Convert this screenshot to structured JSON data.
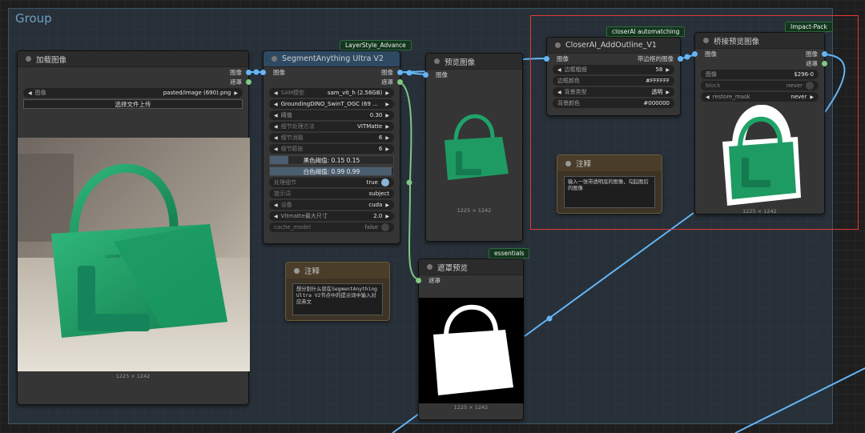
{
  "group": {
    "title": "Group"
  },
  "colors": {
    "accent_blue": "#64b5f6",
    "mask_green": "#81c784",
    "bag_green": "#1e9a63",
    "highlight_red": "#e53935"
  },
  "load_image": {
    "title": "加载图像",
    "outputs": [
      "图像",
      "遮罩"
    ],
    "image_label": "图像",
    "image_value": "pasted/image (690).png",
    "upload_button": "选择文件上传",
    "caption": "1225 × 1242"
  },
  "segment": {
    "badge": "LayerStyle_Advance",
    "title": "SegmentAnything Ultra V2",
    "input": "图像",
    "outputs": [
      "图像",
      "遮罩"
    ],
    "sam_model": {
      "label": "SAM模型",
      "value": "sam_vit_h (2.56GB)"
    },
    "grounding": {
      "value": "GroundingDINO_SwinT_OGC (69 ..."
    },
    "threshold": {
      "label": "阈值",
      "value": "0.30"
    },
    "detail_method": {
      "label": "细节处理方法",
      "value": "VITMatte"
    },
    "detail_erode": {
      "label": "细节消融",
      "value": "6"
    },
    "detail_dilate": {
      "label": "细节膨胀",
      "value": "6"
    },
    "black_point": "黑色阈值: 0.15  0.15",
    "white_point": "白色阈值: 0.99  0.99",
    "process_detail": {
      "label": "处理细节",
      "value": "true"
    },
    "prompt": {
      "label": "提示词",
      "value": "subject"
    },
    "device": {
      "label": "设备",
      "value": "cuda"
    },
    "vitmatte_max": {
      "label": "Vitmatte最大尺寸",
      "value": "2.0"
    },
    "cache_model": {
      "label": "cache_model",
      "value": "false"
    }
  },
  "preview": {
    "title": "预览图像",
    "input": "图像",
    "caption": "1225 × 1242"
  },
  "mask_preview": {
    "badge": "essentials",
    "title": "遮罩预览",
    "input": "遮罩",
    "caption": "1225 × 1242"
  },
  "note1": {
    "title": "注释",
    "text": "想分割什么就在SegmentAnything Ultra V2节点中的提示词中输入对应英文"
  },
  "outline": {
    "badge": "closerAI automatching",
    "title": "CloserAI_AddOutline_V1",
    "input": "图像",
    "output": "带边框的图像",
    "width": {
      "label": "边框粗细",
      "value": "58"
    },
    "color": {
      "label": "边框颜色",
      "value": "#FFFFFF"
    },
    "bg_type": {
      "label": "背景类型",
      "value": "透明"
    },
    "bg_color": {
      "label": "背景颜色",
      "value": "#000000"
    }
  },
  "note2": {
    "title": "注释",
    "text": "输入一张带透明底的图像，勾起图后的图像"
  },
  "bridge": {
    "badge": "Impact-Pack",
    "title": "桥接预览图像",
    "input": "图像",
    "outputs": [
      "图像",
      "遮罩"
    ],
    "image_value": {
      "label": "图像",
      "value": "$296-0"
    },
    "block": {
      "label": "block",
      "value": "never"
    },
    "restore_mask": {
      "label": "restore_mask",
      "value": "never"
    },
    "caption": "1225 × 1242"
  }
}
